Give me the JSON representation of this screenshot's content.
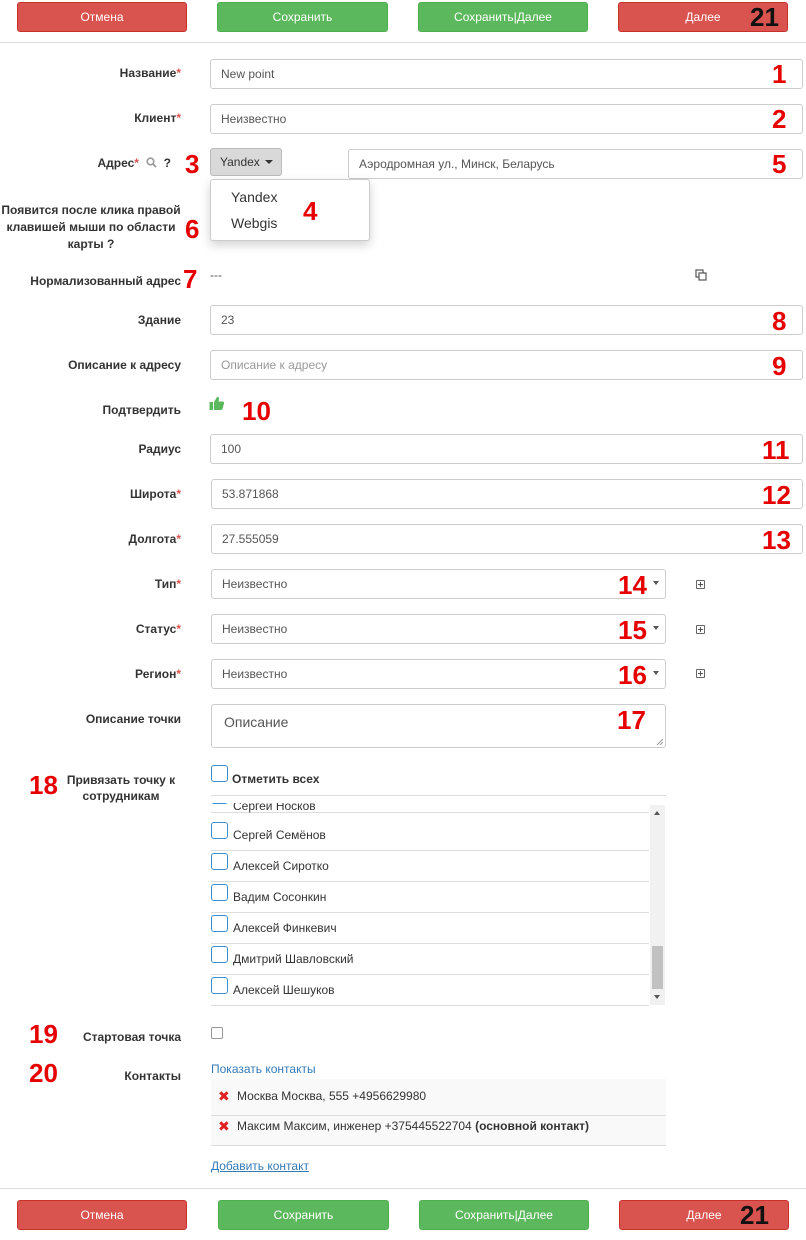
{
  "toolbar": {
    "cancel": "Отмена",
    "save": "Сохранить",
    "save_next": "Сохранить|Далее",
    "next": "Далее"
  },
  "annotations": [
    "1",
    "2",
    "3",
    "4",
    "5",
    "6",
    "7",
    "8",
    "9",
    "10",
    "11",
    "12",
    "13",
    "14",
    "15",
    "16",
    "17",
    "18",
    "19",
    "20",
    "21"
  ],
  "fields": {
    "name": {
      "label": "Название",
      "value": "New point"
    },
    "client": {
      "label": "Клиент",
      "value": "Неизвестно"
    },
    "address": {
      "label": "Адрес",
      "help": "?",
      "provider": "Yandex",
      "provider_options": [
        "Yandex",
        "Webgis"
      ],
      "value": "Аэродромная ул., Минск, Беларусь"
    },
    "hint": "Появится после клика правой клавишей мыши по области карты ?",
    "normalized": {
      "label": "Нормализованный адрес",
      "value": "---"
    },
    "building": {
      "label": "Здание",
      "value": "23"
    },
    "address_desc": {
      "label": "Описание к адресу",
      "placeholder": "Описание к адресу"
    },
    "confirm": {
      "label": "Подтвердить"
    },
    "radius": {
      "label": "Радиус",
      "value": "100"
    },
    "lat": {
      "label": "Широта",
      "value": "53.871868"
    },
    "lon": {
      "label": "Долгота",
      "value": "27.555059"
    },
    "type": {
      "label": "Тип",
      "value": "Неизвестно"
    },
    "status": {
      "label": "Статус",
      "value": "Неизвестно"
    },
    "region": {
      "label": "Регион",
      "value": "Неизвестно"
    },
    "point_desc": {
      "label": "Описание точки",
      "placeholder": "Описание"
    },
    "employees": {
      "label": "Привязать точку к сотрудникам",
      "select_all": "Отметить всех",
      "partial": "Сергей Носков",
      "items": [
        "Сергей Семёнов",
        "Алексей Сиротко",
        "Вадим Сосонкин",
        "Алексей Финкевич",
        "Дмитрий Шавловский",
        "Алексей Шешуков"
      ]
    },
    "start_point": {
      "label": "Стартовая точка"
    },
    "contacts": {
      "label": "Контакты",
      "show": "Показать контакты",
      "items": [
        {
          "text": "Москва Москва, 555 +4956629980",
          "badge": ""
        },
        {
          "text": "Максим Максим, инженер +375445522704",
          "badge": "(основной контакт)"
        }
      ],
      "add": "Добавить контакт"
    }
  }
}
